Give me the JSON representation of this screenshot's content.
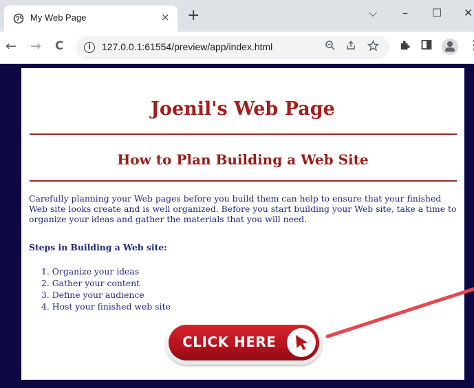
{
  "browser": {
    "tab_title": "My Web Page",
    "tab_close": "×",
    "new_tab": "+",
    "window_controls": {
      "dropdown": "⌵",
      "minimize": "–",
      "maximize": "☐",
      "close": "✕"
    },
    "nav": {
      "back": "←",
      "forward": "→",
      "reload": "C"
    },
    "url": "127.0.0.1:61554/preview/app/index.html",
    "icons": [
      "zoom-icon",
      "share-icon",
      "bookmark-star-icon",
      "extensions-icon",
      "side-panel-icon",
      "profile-icon",
      "menu-icon"
    ]
  },
  "page": {
    "title": "Joenil's Web Page",
    "subtitle": "How to Plan Building a Web Site",
    "intro": "Carefully planning your Web pages before you build them can help to ensure that your finished Web site looks create and is well organized. Before you start building your Web site, take a time to organize your ideas and gather the materials that you will need.",
    "steps_heading": "Steps in Building a Web site:",
    "steps": [
      "1. Organize your ideas",
      "2. Gather your content",
      "3. Define your audience",
      "4. Host your finished web site"
    ],
    "cta_label": "CLICK HERE"
  },
  "colors": {
    "page_background": "#0d0842",
    "heading": "#a01f1c",
    "body_text": "#1f2a7a",
    "button": "#c41a24",
    "annotation_arrow": "#e8474f"
  }
}
